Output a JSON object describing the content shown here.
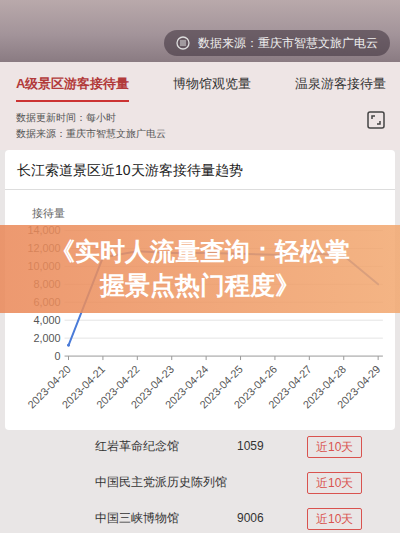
{
  "header": {
    "source_badge": "数据来源：重庆市智慧文旅广电云"
  },
  "tabs": [
    {
      "label": "A级景区游客接待量",
      "selected": true
    },
    {
      "label": "博物馆观览量",
      "selected": false
    },
    {
      "label": "温泉游客接待量",
      "selected": false
    }
  ],
  "info": {
    "update_time": "数据更新时间：每小时",
    "source": "数据来源：重庆市智慧文旅广电云"
  },
  "chart": {
    "title": "长江索道景区近10天游客接待量趋势",
    "y_label": "接待量",
    "y_ticks": [
      "0",
      "2,000",
      "4,000",
      "6,000",
      "8,000",
      "10,000",
      "12,000",
      "14,000"
    ],
    "x_labels": [
      "2023-04-20",
      "2023-04-21",
      "2023-04-22",
      "2023-04-23",
      "2023-04-24",
      "2023-04-25",
      "2023-04-26",
      "2023-04-27",
      "2023-04-28",
      "2023-04-29"
    ],
    "series": [
      {
        "values": [
          1200,
          11000,
          11700,
          11500,
          11500,
          11400,
          11300,
          11500,
          11200,
          8000
        ]
      }
    ]
  },
  "banner": {
    "title": "《实时人流量查询：轻松掌握景点热门程度》"
  },
  "rows": [
    {
      "name": "红岩革命纪念馆",
      "count": "1059",
      "button": "近10天"
    },
    {
      "name": "中国民主党派历史陈列馆",
      "button": "近10天"
    },
    {
      "name": "中国三峡博物馆",
      "count": "9006",
      "button": "近10天"
    }
  ]
}
